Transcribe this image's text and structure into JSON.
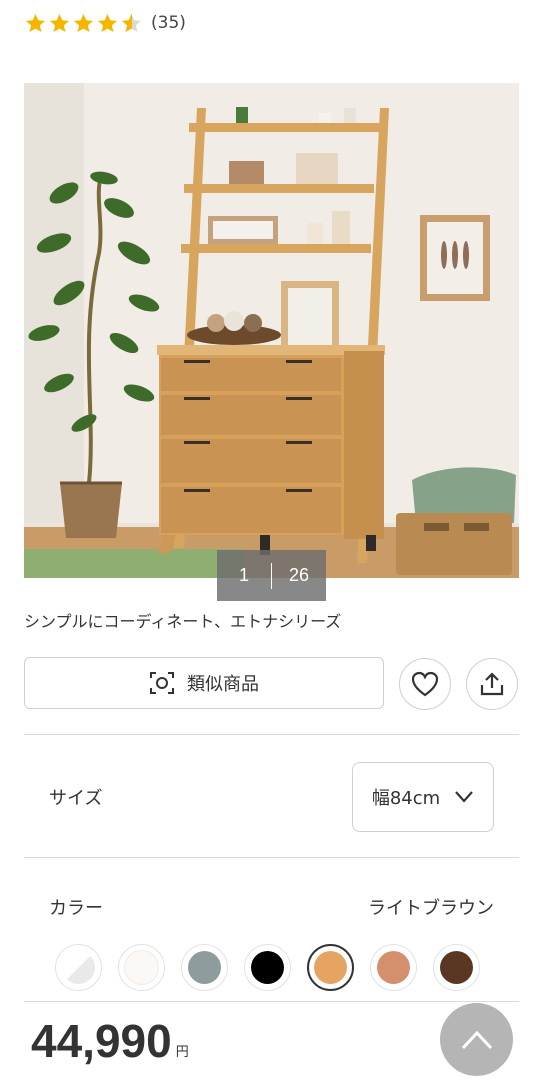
{
  "rating": {
    "stars": [
      {
        "fill": "full"
      },
      {
        "fill": "full"
      },
      {
        "fill": "full"
      },
      {
        "fill": "full"
      },
      {
        "fill": "half"
      }
    ],
    "count_text": "(35)",
    "star_color": "#f7b500"
  },
  "gallery": {
    "current": "1",
    "total": "26",
    "caption": "シンプルにコーディネート、エトナシリーズ"
  },
  "actions": {
    "similar_label": "類似商品",
    "favorite_icon": "heart-icon",
    "share_icon": "share-icon"
  },
  "size": {
    "label": "サイズ",
    "selected": "幅84cm"
  },
  "color": {
    "label": "カラー",
    "selected_name": "ライトブラウン",
    "swatches": [
      {
        "color": "#e9e9e9",
        "selected": false
      },
      {
        "color": "#fbf8f5",
        "selected": false
      },
      {
        "color": "#8e9c9d",
        "selected": false
      },
      {
        "color": "#000000",
        "selected": false
      },
      {
        "color": "#e6a463",
        "selected": true
      },
      {
        "color": "#d48f6c",
        "selected": false
      },
      {
        "color": "#5a3722",
        "selected": false
      }
    ]
  },
  "price": {
    "value": "44,990",
    "unit": "円"
  },
  "scroll_top_icon": "chevron-up-icon"
}
